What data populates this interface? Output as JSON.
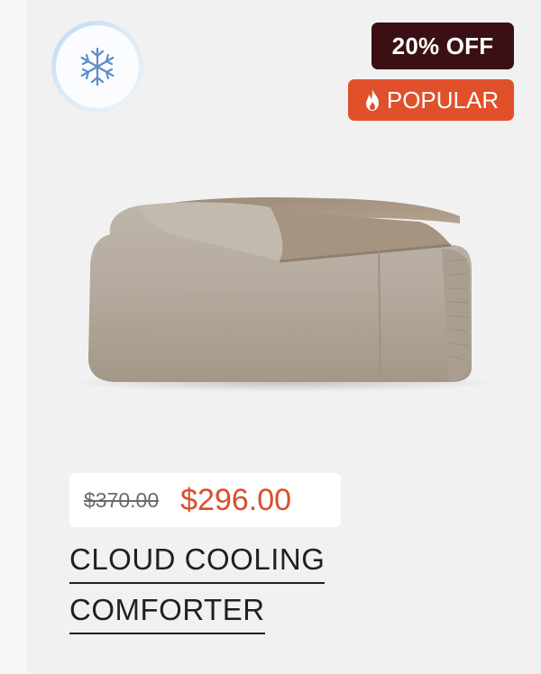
{
  "badges": {
    "cooling_icon": "snowflake-icon",
    "discount": "20% OFF",
    "popular": "POPULAR",
    "popular_icon": "flame-icon"
  },
  "product": {
    "image_alt": "Cloud Cooling Comforter folded",
    "price_original": "$370.00",
    "price_sale": "$296.00",
    "title_line1": "CLOUD COOLING",
    "title_line2": "COMFORTER"
  },
  "colors": {
    "discount_bg": "#3a1014",
    "popular_bg": "#e0502b",
    "sale_price": "#d94e2b",
    "product_fabric": "#b3a99c"
  }
}
